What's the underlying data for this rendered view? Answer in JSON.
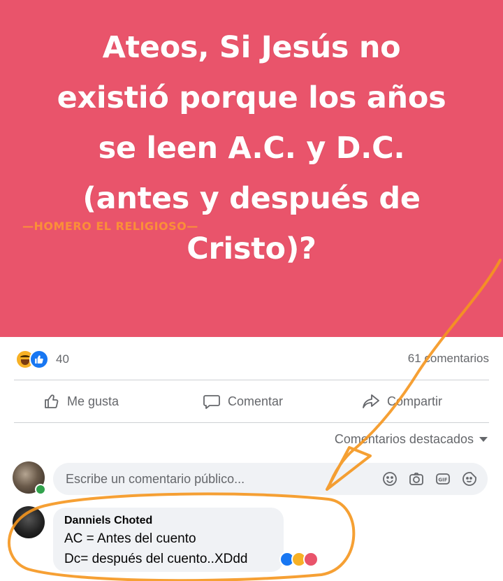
{
  "post": {
    "lines": [
      "Ateos, Si Jesús no",
      "existió porque los años",
      "se leen A.C. y D.C.",
      "(antes y después de",
      "Cristo)?"
    ],
    "watermark": "—HOMERO EL RELIGIOSO—",
    "bg_color": "#e9546b"
  },
  "stats": {
    "reaction_icons": [
      "haha-icon",
      "like-icon"
    ],
    "reaction_count": "40",
    "comments": "61 comentarios"
  },
  "actions": {
    "like": "Me gusta",
    "comment": "Comentar",
    "share": "Compartir"
  },
  "sort": {
    "label": "Comentarios destacados"
  },
  "composer": {
    "placeholder": "Escribe un comentario público...",
    "icons": [
      "emoji-icon",
      "camera-icon",
      "gif-icon",
      "sticker-icon"
    ]
  },
  "comment": {
    "author": "Danniels Choted",
    "line1": "AC = Antes del cuento",
    "line2": "Dc= después del cuento..XDdd",
    "reaction_icons": [
      "like-icon",
      "haha-icon",
      "care-icon"
    ]
  },
  "colors": {
    "accent_annotation": "#f5961e",
    "facebook_blue": "#1877f2",
    "muted_text": "#65676b"
  }
}
